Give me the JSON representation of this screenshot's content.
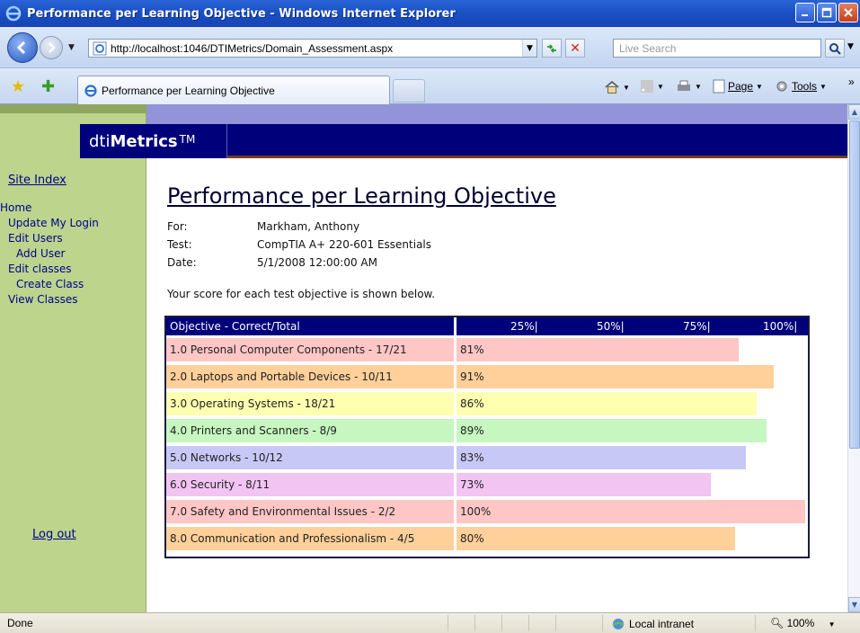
{
  "window": {
    "title": "Performance per Learning Objective - Windows Internet Explorer"
  },
  "addressbar": {
    "url": "http://localhost:1046/DTIMetrics/Domain_Assessment.aspx",
    "search_placeholder": "Live Search"
  },
  "tab": {
    "label": "Performance per Learning Objective"
  },
  "commands": {
    "page": "Page",
    "tools": "Tools"
  },
  "sidebar": {
    "site_index": "Site Index",
    "items": [
      {
        "label": "Home",
        "level": 0
      },
      {
        "label": "Update My Login",
        "level": 1
      },
      {
        "label": "Edit Users",
        "level": 1
      },
      {
        "label": "Add User",
        "level": 2
      },
      {
        "label": "Edit classes",
        "level": 1
      },
      {
        "label": "Create Class",
        "level": 2
      },
      {
        "label": "View Classes",
        "level": 1
      }
    ],
    "logout": "Log out"
  },
  "header": {
    "brand_prefix": "dti",
    "brand_bold": "Metrics",
    "brand_tm": "TM"
  },
  "page": {
    "title": "Performance per Learning Objective",
    "for_label": "For:",
    "for_value": "Markham, Anthony",
    "test_label": "Test:",
    "test_value": "CompTIA A+ 220-601 Essentials",
    "date_label": "Date:",
    "date_value": "5/1/2008 12:00:00 AM",
    "intro": "Your score for each test objective is shown below."
  },
  "score_table": {
    "header": "Objective - Correct/Total",
    "ticks": [
      "25%|",
      "50%|",
      "75%|",
      "100%|"
    ],
    "rows": [
      {
        "label": "1.0 Personal Computer Components - 17/21",
        "percent_text": "81%",
        "percent": 81,
        "color": "#ffc6c6"
      },
      {
        "label": "2.0 Laptops and Portable Devices - 10/11",
        "percent_text": "91%",
        "percent": 91,
        "color": "#ffd09a"
      },
      {
        "label": "3.0 Operating Systems - 18/21",
        "percent_text": "86%",
        "percent": 86,
        "color": "#ffffb0"
      },
      {
        "label": "4.0 Printers and Scanners - 8/9",
        "percent_text": "89%",
        "percent": 89,
        "color": "#c6f7c0"
      },
      {
        "label": "5.0 Networks - 10/12",
        "percent_text": "83%",
        "percent": 83,
        "color": "#c8c8f7"
      },
      {
        "label": "6.0 Security - 8/11",
        "percent_text": "73%",
        "percent": 73,
        "color": "#f2c4f2"
      },
      {
        "label": "7.0 Safety and Environmental Issues - 2/2",
        "percent_text": "100%",
        "percent": 100,
        "color": "#ffc6c6"
      },
      {
        "label": "8.0 Communication and Professionalism - 4/5",
        "percent_text": "80%",
        "percent": 80,
        "color": "#ffd09a"
      }
    ]
  },
  "statusbar": {
    "status": "Done",
    "zone": "Local intranet",
    "zoom": "100%"
  }
}
